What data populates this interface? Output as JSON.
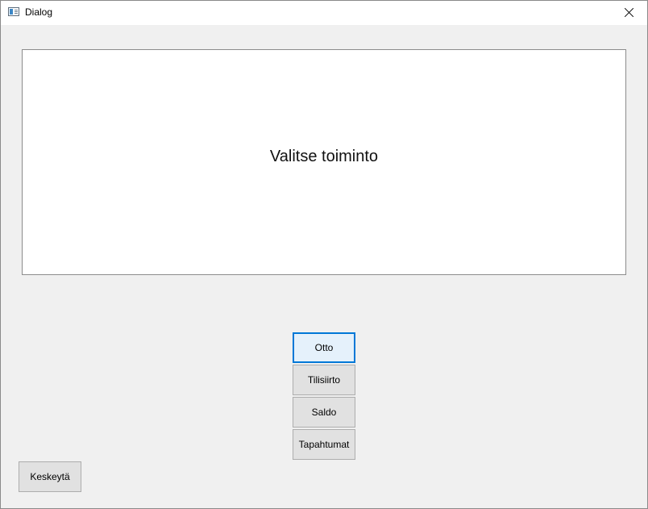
{
  "window": {
    "title": "Dialog",
    "icon": "window-app-icon",
    "close_icon": "close-icon"
  },
  "info_panel": {
    "text": "Valitse toiminto"
  },
  "actions": [
    {
      "label": "Otto"
    },
    {
      "label": "Tilisiirto"
    },
    {
      "label": "Saldo"
    },
    {
      "label": "Tapahtumat"
    }
  ],
  "cancel_label": "Keskeytä",
  "colors": {
    "focus_border": "#0078d7",
    "button_face": "#e1e1e1",
    "background": "#f0f0f0"
  }
}
